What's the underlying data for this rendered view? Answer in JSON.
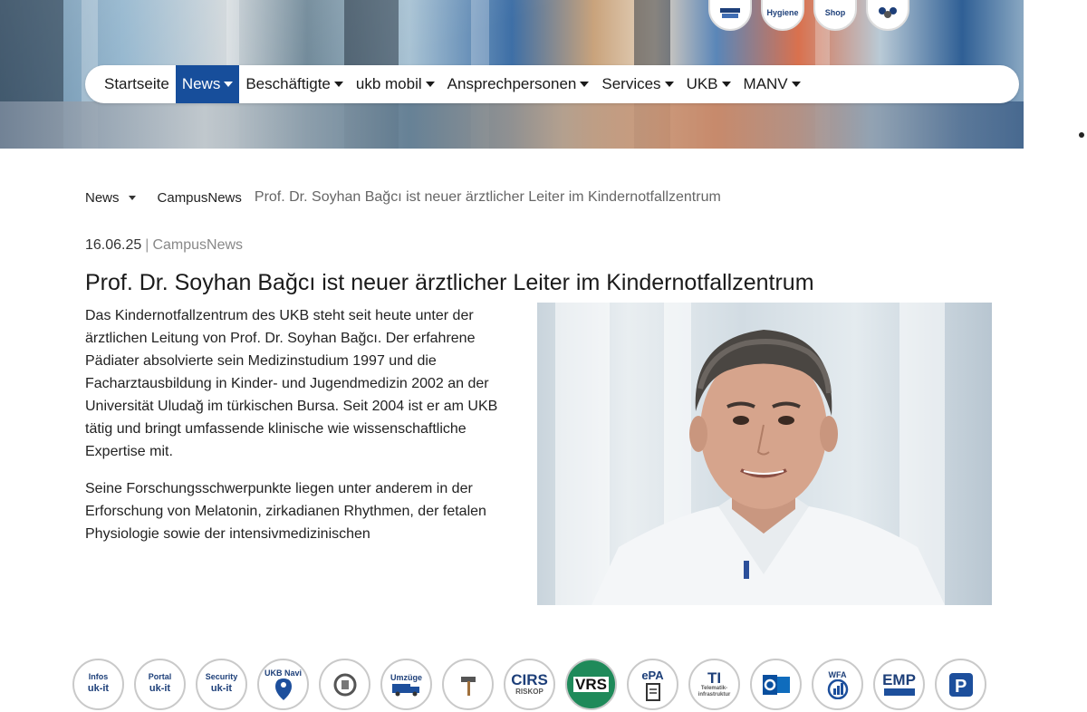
{
  "header": {
    "top_icons": [
      {
        "label": "",
        "icon": "books-icon"
      },
      {
        "label": "Hygiene",
        "icon": "hygiene-book-icon"
      },
      {
        "label": "Shop",
        "icon": "shop-cart-icon"
      },
      {
        "label": "",
        "icon": "people-group-icon"
      }
    ]
  },
  "nav": {
    "items": [
      {
        "label": "Startseite",
        "active": false,
        "dropdown": false
      },
      {
        "label": "News",
        "active": true,
        "dropdown": true
      },
      {
        "label": "Beschäftigte",
        "active": false,
        "dropdown": true
      },
      {
        "label": "ukb mobil",
        "active": false,
        "dropdown": true
      },
      {
        "label": "Ansprechpersonen",
        "active": false,
        "dropdown": true
      },
      {
        "label": "Services",
        "active": false,
        "dropdown": true
      },
      {
        "label": "UKB",
        "active": false,
        "dropdown": true
      },
      {
        "label": "MANV",
        "active": false,
        "dropdown": true
      }
    ],
    "active_color": "#174e9b"
  },
  "breadcrumb": {
    "root": "News",
    "section": "CampusNews",
    "current": "Prof. Dr. Soyhan Bağcı ist neuer ärztlicher Leiter im Kindernotfallzentrum"
  },
  "article": {
    "date": "16.06.25",
    "separator": "|",
    "category": "CampusNews",
    "title": "Prof. Dr. Soyhan Bağcı ist neuer ärztlicher Leiter im Kindernotfallzentrum",
    "paragraphs": [
      "Das Kindernotfallzentrum des UKB steht seit heute unter der ärztlichen Leitung von Prof. Dr. Soyhan Bağcı. Der erfahrene Pädiater absolvierte sein Medizinstudium 1997 und die Facharztausbildung in Kinder- und Jugendmedizin 2002 an der Universität Uludağ im türkischen Bursa. Seit 2004 ist er am UKB tätig und bringt umfassende klinische wie wissenschaftliche Expertise mit.",
      "Seine Forschungsschwerpunkte liegen unter anderem in der Erforschung von Melatonin, zirkadianen Rhythmen, der fetalen Physiologie sowie der intensivmedizinischen"
    ]
  },
  "tools": [
    {
      "top": "Infos",
      "main": "uk-it",
      "icon": "infos-ukit-icon"
    },
    {
      "top": "Portal",
      "main": "uk-it",
      "icon": "portal-ukit-icon"
    },
    {
      "top": "Security",
      "main": "uk-it",
      "icon": "security-ukit-icon"
    },
    {
      "top": "UKB Navi",
      "main": "",
      "icon": "navigation-person-icon"
    },
    {
      "top": "",
      "main": "",
      "icon": "recycling-bin-icon"
    },
    {
      "top": "Umzüge",
      "main": "",
      "icon": "moving-truck-icon"
    },
    {
      "top": "",
      "main": "",
      "icon": "repair-hammer-icon"
    },
    {
      "top": "CIRS",
      "main": "RISKOP",
      "icon": "cirs-riskop-icon"
    },
    {
      "top": "VRS",
      "main": "",
      "icon": "vrs-icon"
    },
    {
      "top": "ePA",
      "main": "",
      "icon": "epa-document-icon"
    },
    {
      "top": "TI",
      "main": "Telematik-infrastruktur",
      "icon": "telematik-icon"
    },
    {
      "top": "",
      "main": "",
      "icon": "outlook-mail-icon"
    },
    {
      "top": "WFA",
      "main": "",
      "icon": "wfa-chart-icon"
    },
    {
      "top": "EMP",
      "main": "",
      "icon": "emp-icon"
    },
    {
      "top": "",
      "main": "",
      "icon": "parking-icon"
    }
  ]
}
